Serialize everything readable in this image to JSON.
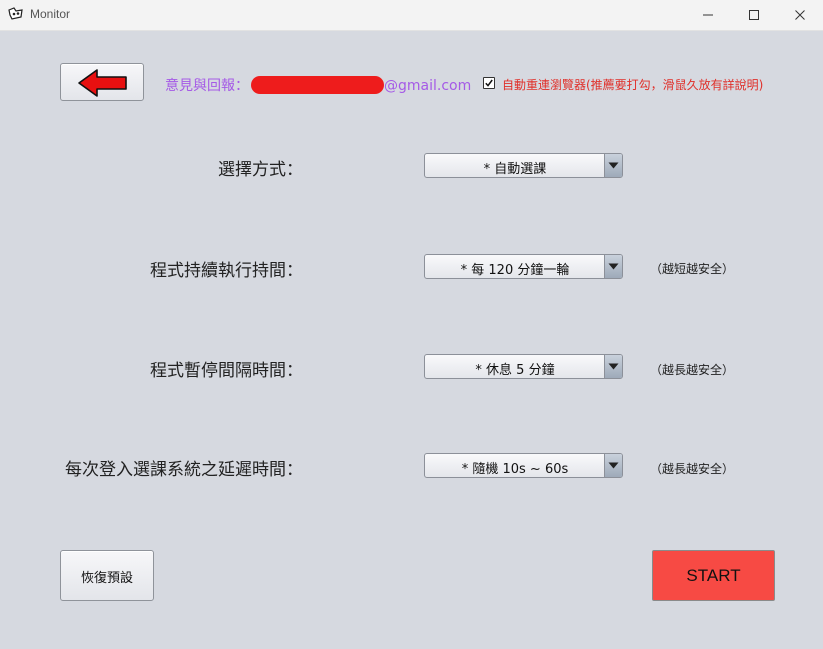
{
  "window": {
    "title": "Monitor"
  },
  "feedback": {
    "label": "意見與回報：",
    "email_suffix": "@gmail.com"
  },
  "auto_reconnect": {
    "checked": true,
    "label": "自動重連瀏覽器(推薦要打勾，滑鼠久放有詳說明)"
  },
  "settings": [
    {
      "label": "選擇方式：",
      "value": "* 自動選課",
      "hint": ""
    },
    {
      "label": "程式持續執行持間：",
      "value": "* 每 120 分鐘一輪",
      "hint": "（越短越安全）"
    },
    {
      "label": "程式暫停間隔時間：",
      "value": "* 休息 5 分鐘",
      "hint": "（越長越安全）"
    },
    {
      "label": "每次登入選課系統之延遲時間：",
      "value": "* 隨機 10s ~ 60s",
      "hint": "（越長越安全）"
    }
  ],
  "buttons": {
    "reset": "恢復預設",
    "start": "START"
  },
  "colors": {
    "start_bg": "#f74a44",
    "feedback_text": "#a55ae6",
    "checkbox_text": "#e0302a",
    "redaction": "#ee1c1c"
  }
}
